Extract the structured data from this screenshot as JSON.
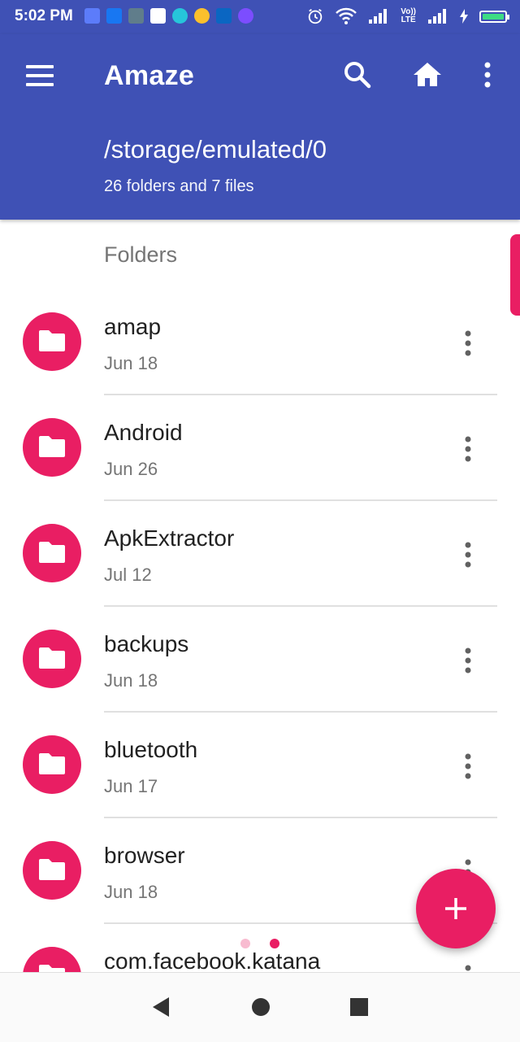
{
  "status_bar": {
    "time": "5:02 PM",
    "notification_icons": [
      "usb-icon",
      "facebook-icon",
      "app-icon",
      "gmail-icon",
      "chat-icon",
      "chrome-icon",
      "linkedin-icon",
      "app-icon"
    ],
    "network_label_top": "Vo))",
    "network_label_bottom": "LTE"
  },
  "app_bar": {
    "title": "Amaze",
    "path": "/storage/emulated/0",
    "summary": "26 folders and 7 files",
    "color": "#3f51b5"
  },
  "section": {
    "label": "Folders"
  },
  "accent_color": "#e91e63",
  "folders": [
    {
      "name": "amap",
      "date": "Jun 18"
    },
    {
      "name": "Android",
      "date": "Jun 26"
    },
    {
      "name": "ApkExtractor",
      "date": "Jul 12"
    },
    {
      "name": "backups",
      "date": "Jun 18"
    },
    {
      "name": "bluetooth",
      "date": "Jun 17"
    },
    {
      "name": "browser",
      "date": "Jun 18"
    },
    {
      "name": "com.facebook.katana",
      "date": ""
    }
  ]
}
